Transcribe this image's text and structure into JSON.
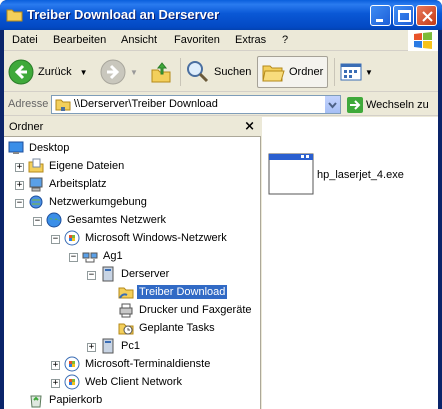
{
  "window": {
    "title": "Treiber Download an Derserver"
  },
  "menu": [
    "Datei",
    "Bearbeiten",
    "Ansicht",
    "Favoriten",
    "Extras",
    "?"
  ],
  "toolbar": {
    "back": "Zurück",
    "search": "Suchen",
    "folders": "Ordner"
  },
  "address": {
    "label": "Adresse",
    "value": "\\\\Derserver\\Treiber Download",
    "go": "Wechseln zu"
  },
  "folder_pane": {
    "title": "Ordner",
    "close": "×",
    "tree": [
      {
        "label": "Desktop"
      },
      {
        "label": "Eigene Dateien"
      },
      {
        "label": "Arbeitsplatz"
      },
      {
        "label": "Netzwerkumgebung"
      },
      {
        "label": "Gesamtes Netzwerk"
      },
      {
        "label": "Microsoft Windows-Netzwerk"
      },
      {
        "label": "Ag1"
      },
      {
        "label": "Derserver"
      },
      {
        "label": "Treiber Download",
        "selected": true
      },
      {
        "label": "Drucker und Faxgeräte"
      },
      {
        "label": "Geplante Tasks"
      },
      {
        "label": "Pc1"
      },
      {
        "label": "Microsoft-Terminaldienste"
      },
      {
        "label": "Web Client Network"
      },
      {
        "label": "Papierkorb"
      }
    ]
  },
  "files": [
    {
      "name": "hp_laserjet_4.exe",
      "icon": "exe-icon"
    }
  ],
  "colors": {
    "titlebar": "#0a58d6",
    "selection": "#316ac5",
    "chrome": "#ece9d8"
  }
}
